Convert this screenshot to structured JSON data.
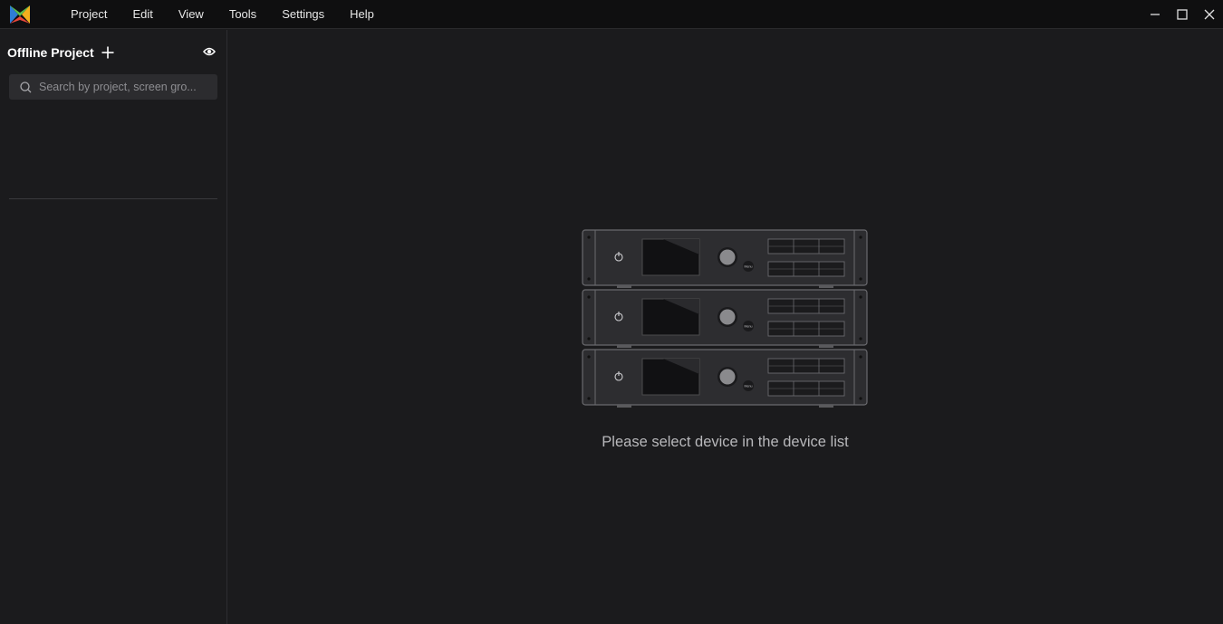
{
  "app": {
    "logo_icon": "app-logo-icon"
  },
  "menu": {
    "items": [
      "Project",
      "Edit",
      "View",
      "Tools",
      "Settings",
      "Help"
    ]
  },
  "window_controls": {
    "minimize_icon": "minimize-icon",
    "maximize_icon": "maximize-icon",
    "close_icon": "close-icon"
  },
  "sidebar": {
    "title": "Offline Project",
    "add_icon": "plus-icon",
    "visibility_icon": "eye-icon",
    "search": {
      "placeholder": "Search by project, screen gro...",
      "value": ""
    }
  },
  "main": {
    "empty_message": "Please select device in the device list",
    "illustration": "device-rack-illustration",
    "device_label": "Menu"
  },
  "colors": {
    "background": "#1b1b1d",
    "titlebar": "#0f0f10",
    "search_bg": "#2c2c2f",
    "text_muted": "#b8b8bb"
  }
}
